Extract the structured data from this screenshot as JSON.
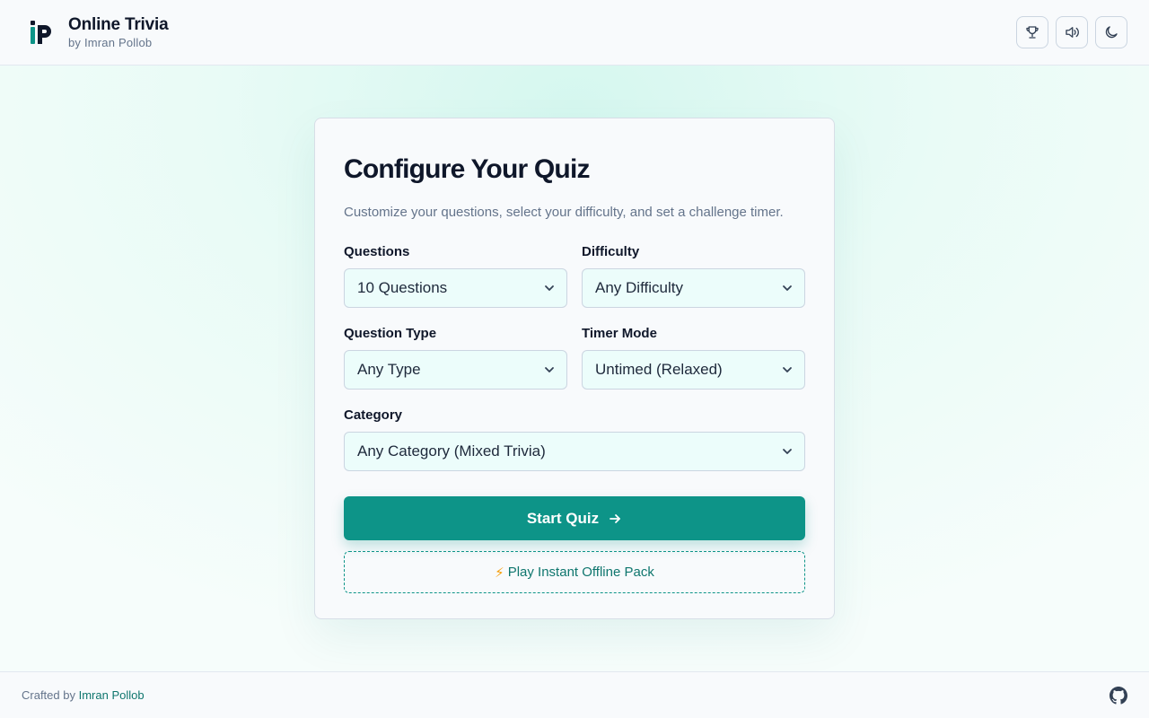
{
  "header": {
    "title": "Online Trivia",
    "subtitle": "by Imran Pollob",
    "actions": [
      {
        "icon": "trophy-icon"
      },
      {
        "icon": "speaker-icon"
      },
      {
        "icon": "moon-icon"
      }
    ]
  },
  "card": {
    "title": "Configure Your Quiz",
    "subtitle": "Customize your questions, select your difficulty, and set a challenge timer.",
    "fields": {
      "questions": {
        "label": "Questions",
        "value": "10 Questions"
      },
      "difficulty": {
        "label": "Difficulty",
        "value": "Any Difficulty"
      },
      "type": {
        "label": "Question Type",
        "value": "Any Type"
      },
      "timer": {
        "label": "Timer Mode",
        "value": "Untimed (Relaxed)"
      },
      "category": {
        "label": "Category",
        "value": "Any Category (Mixed Trivia)"
      }
    },
    "start_label": "Start Quiz",
    "offline_label": "Play Instant Offline Pack"
  },
  "footer": {
    "prefix": "Crafted by",
    "author": "Imran Pollob"
  },
  "colors": {
    "accent": "#0d9488",
    "accent_dark": "#0f766e",
    "text": "#0f172a",
    "muted": "#64748b"
  }
}
